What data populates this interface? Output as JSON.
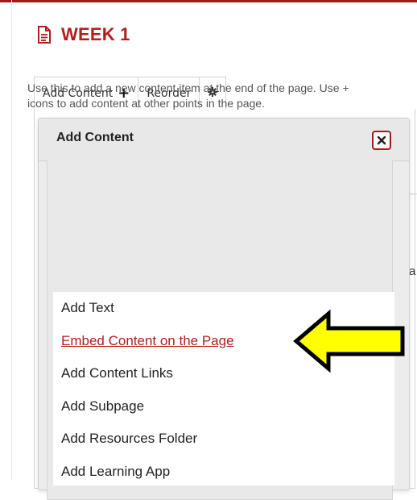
{
  "page": {
    "title": "WEEK 1"
  },
  "toolbar": {
    "add_content_label": "Add Content",
    "add_symbol": "+",
    "reorder_label": "Reorder"
  },
  "dialog": {
    "title": "Add Content",
    "description": "Use this to add a new content item at the end of the page. Use + icons to add content at other points in the page.",
    "items": [
      {
        "label": "Add Text"
      },
      {
        "label": "Embed Content on the Page"
      },
      {
        "label": "Add Content Links"
      },
      {
        "label": "Add Subpage"
      },
      {
        "label": "Add Resources Folder"
      },
      {
        "label": "Add Learning App"
      }
    ]
  },
  "background": {
    "peek_text": "a"
  },
  "colors": {
    "accent": "#b01e1e",
    "topbar": "#9d1b1b",
    "arrow_fill": "#ffff00"
  }
}
